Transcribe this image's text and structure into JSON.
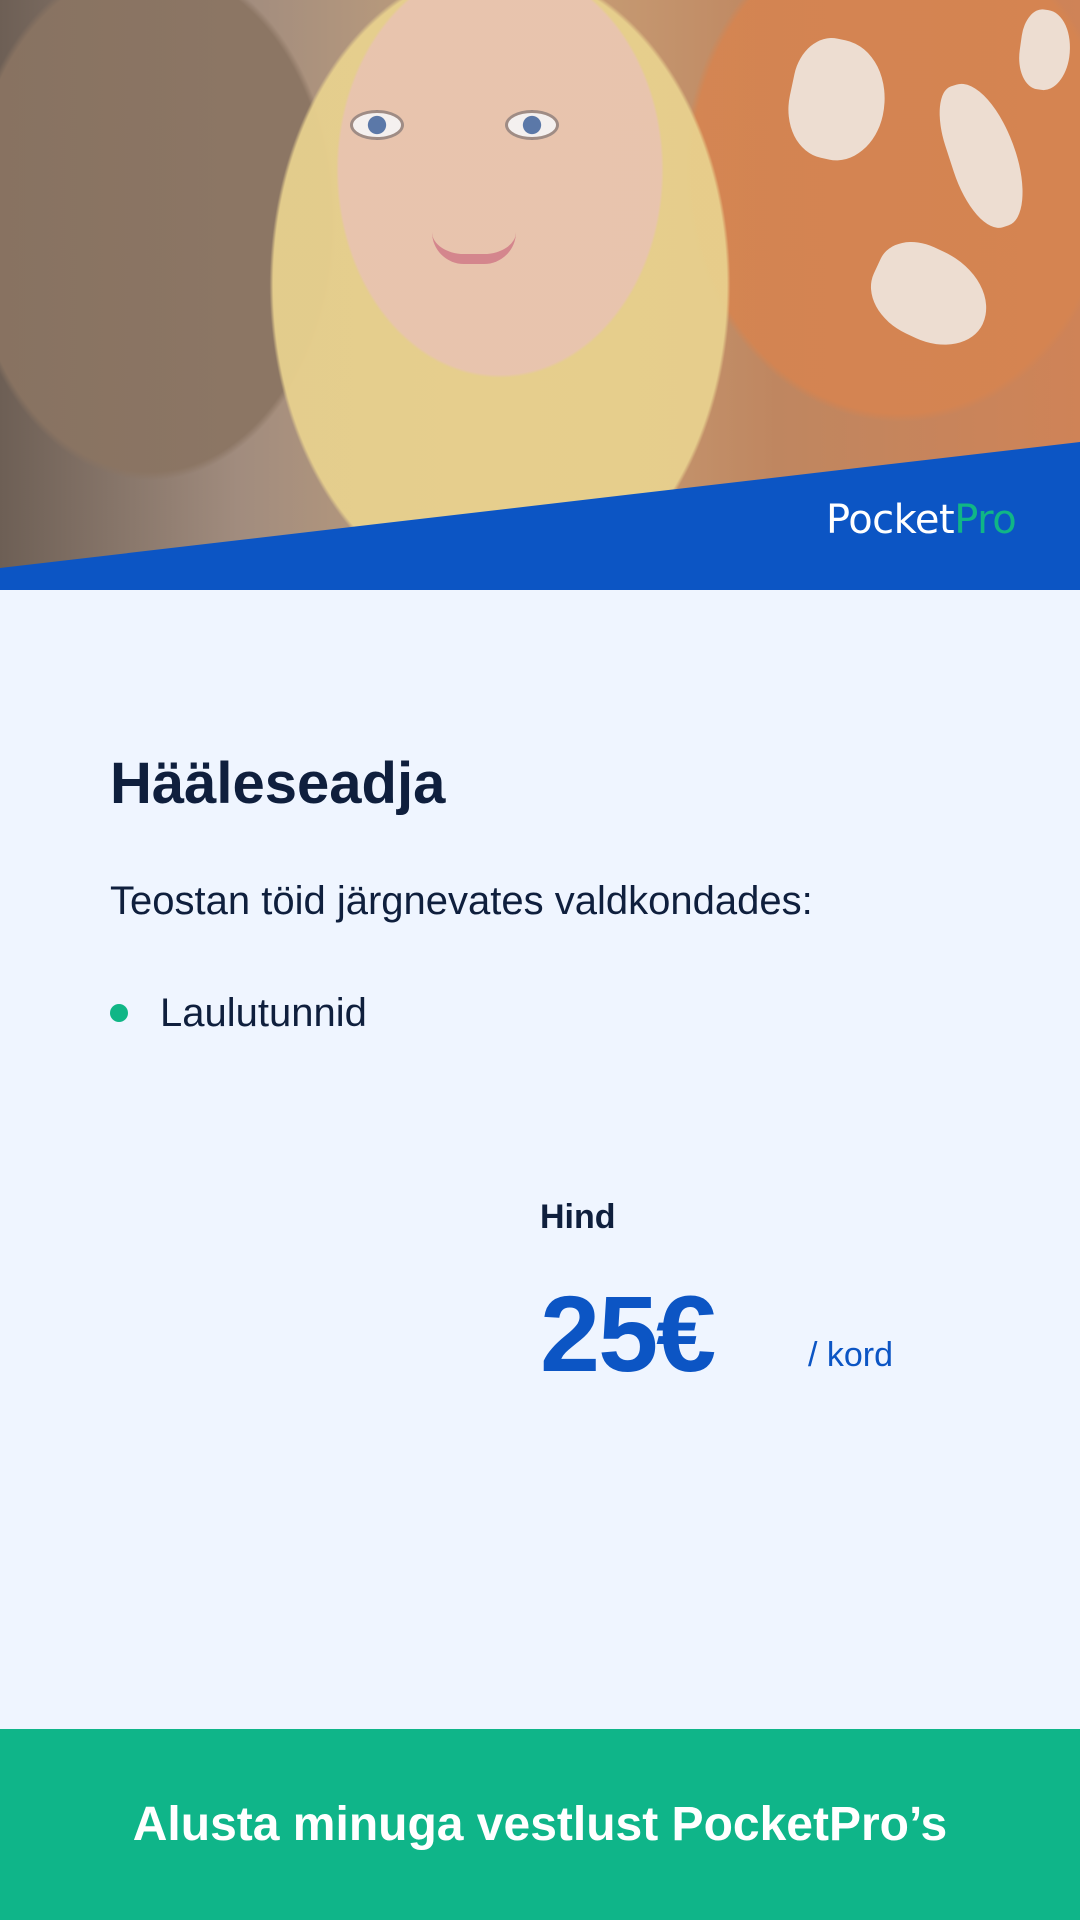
{
  "hero": {
    "photo_icon": "portrait-photo",
    "brand": {
      "primary_text": "Pocket",
      "accent_text": "Pro",
      "primary_color": "#ffffff",
      "accent_color": "#10b686",
      "band_color": "#0c55c4"
    }
  },
  "profile": {
    "title": "Hääleseadja",
    "subtitle": "Teostan töid järgnevates valdkondades:",
    "services": [
      {
        "label": "Laulutunnid",
        "bullet_color": "#10b686"
      }
    ]
  },
  "pricing": {
    "label": "Hind",
    "amount": "25€",
    "unit": "/ kord",
    "price_color": "#0c55c4"
  },
  "cta": {
    "label": "Alusta minuga vestlust PocketPro’s",
    "background_color": "#0fb589",
    "text_color": "#ffffff"
  }
}
